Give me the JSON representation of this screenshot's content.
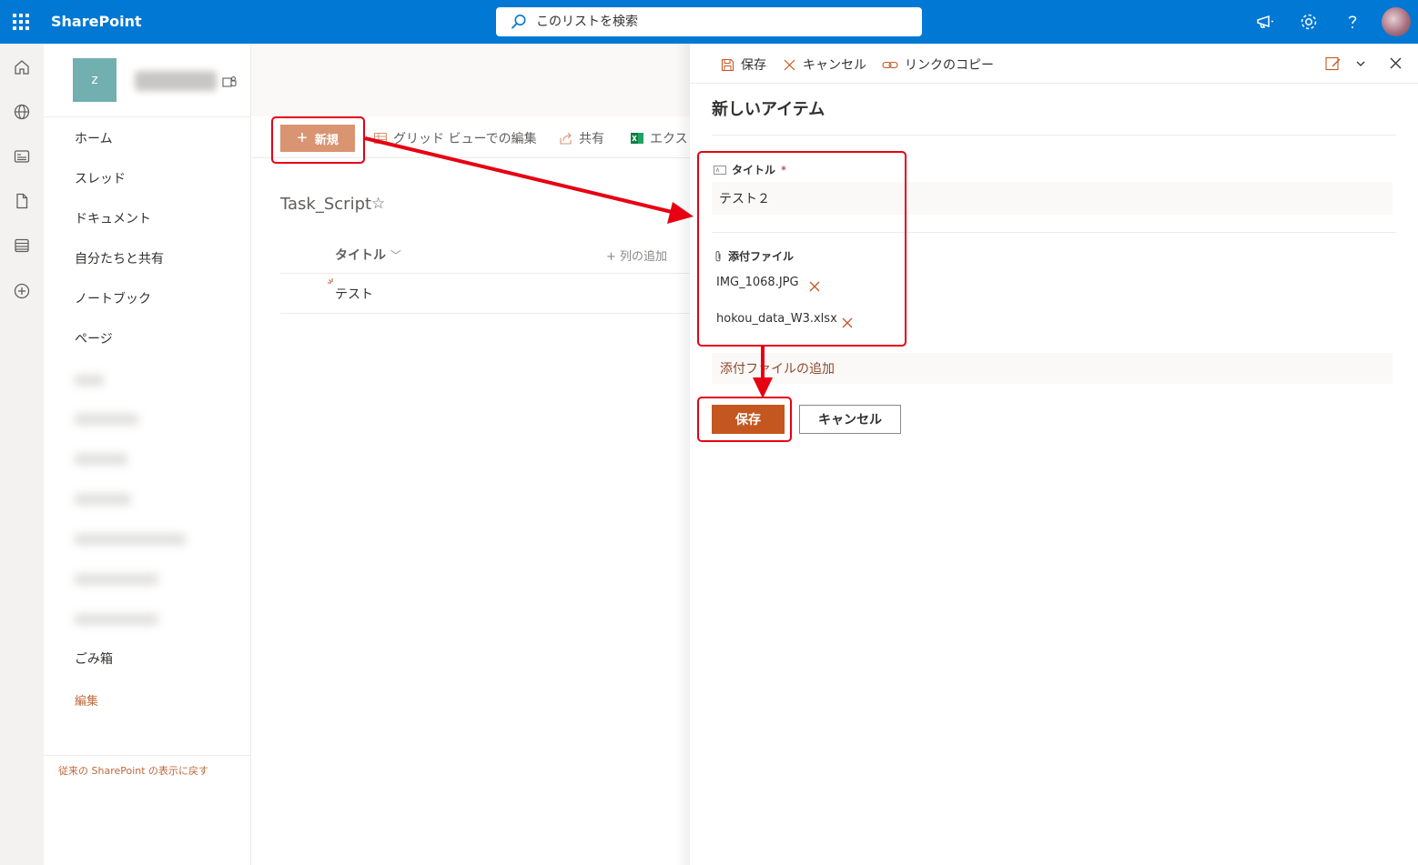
{
  "app": {
    "title": "SharePoint"
  },
  "search": {
    "placeholder": "このリストを検索"
  },
  "site": {
    "logo_letter": "z"
  },
  "nav": {
    "items": [
      {
        "label": "ホーム"
      },
      {
        "label": "スレッド"
      },
      {
        "label": "ドキュメント"
      },
      {
        "label": "自分たちと共有"
      },
      {
        "label": "ノートブック"
      },
      {
        "label": "ページ"
      },
      {
        "label": "ごみ箱"
      }
    ],
    "edit_label": "編集",
    "classic_label": "従来の SharePoint の表示に戻す"
  },
  "toolbar": {
    "new_label": "新規",
    "grid_edit_label": "グリッド ビューでの編集",
    "share_label": "共有",
    "export_label": "エクス"
  },
  "list": {
    "name": "Task_Script",
    "column_title": "タイトル",
    "add_column_label": "列の追加",
    "rows": [
      {
        "title": "テスト"
      }
    ]
  },
  "panel": {
    "save_cmd": "保存",
    "cancel_cmd": "キャンセル",
    "copy_link_cmd": "リンクのコピー",
    "heading": "新しいアイテム",
    "title_field": {
      "label": "タイトル",
      "required_mark": "*",
      "value": "テスト２"
    },
    "attachments": {
      "label": "添付ファイル",
      "files": [
        {
          "name": "IMG_1068.JPG"
        },
        {
          "name": "hokou_data_W3.xlsx"
        }
      ],
      "add_label": "添付ファイルの追加"
    },
    "save_button": "保存",
    "cancel_button": "キャンセル"
  },
  "colors": {
    "suite_bar": "#0078d4",
    "accent": "#c4571f",
    "new_button": "#d99471",
    "annotation": "#e60012"
  }
}
